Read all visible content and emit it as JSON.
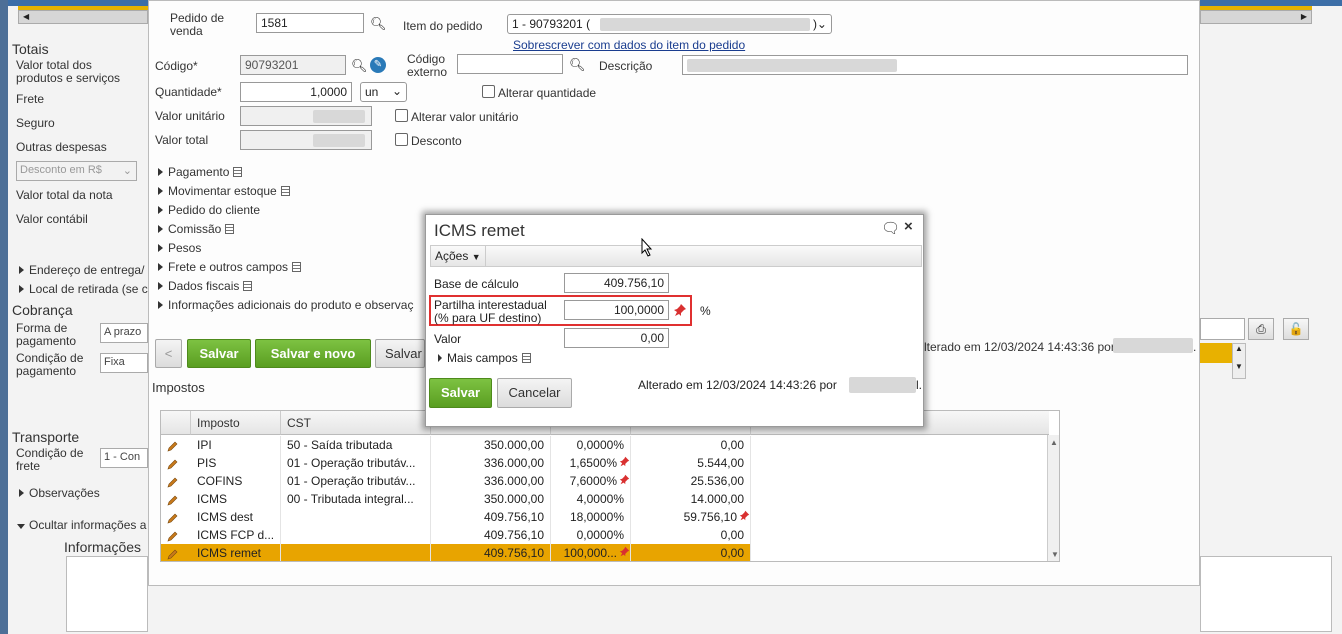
{
  "background": {
    "totais": {
      "title": "Totais",
      "items": [
        "Valor total dos produtos e serviços",
        "Frete",
        "Seguro",
        "Outras despesas"
      ],
      "desconto_select": "Desconto em R$",
      "items2": [
        "Valor total da nota",
        "Valor contábil"
      ]
    },
    "expanders": [
      "Endereço de entrega/",
      "Local de retirada (se c"
    ],
    "cobranca": {
      "title": "Cobrança",
      "forma_label": "Forma de pagamento",
      "forma_value": "A prazo",
      "condicao_label": "Condição de pagamento",
      "condicao_value": "Fixa"
    },
    "transporte": {
      "title": "Transporte",
      "condicao_frete_label": "Condição de frete",
      "condicao_frete_value": "1 - Con"
    },
    "observacoes": "Observações",
    "ocultar": "Ocultar informações a",
    "informacoes": "Informações",
    "right_altered": "lterado em 12/03/2024 14:43:36 por"
  },
  "form": {
    "pedido_venda_label": "Pedido de venda",
    "pedido_venda_value": "1581",
    "item_pedido_label": "Item do pedido",
    "item_pedido_value": "1 - 90793201 (",
    "sobrescrever_link": "Sobrescrever com dados do item do pedido",
    "codigo_label": "Código*",
    "codigo_value": "90793201",
    "codigo_externo_label": "Código externo",
    "descricao_label": "Descrição",
    "quantidade_label": "Quantidade*",
    "quantidade_value": "1,0000",
    "unidade_value": "un",
    "alterar_quantidade": "Alterar quantidade",
    "valor_unitario_label": "Valor unitário",
    "alterar_valor_unitario": "Alterar valor unitário",
    "valor_total_label": "Valor total",
    "desconto": "Desconto",
    "sections": [
      "Pagamento",
      "Movimentar estoque",
      "Pedido do cliente",
      "Comissão",
      "Pesos",
      "Frete e outros campos",
      "Dados fiscais",
      "Informações adicionais do produto e observaç"
    ],
    "prev_button": "<",
    "salvar_button": "Salvar",
    "salvar_novo_button": "Salvar e novo",
    "salvar_cut_button": "Salvar",
    "impostos_title": "Impostos"
  },
  "tax_table": {
    "headers": [
      "Imposto",
      "CST"
    ],
    "rows": [
      {
        "imposto": "IPI",
        "cst": "50 - Saída tributada",
        "base": "350.000,00",
        "aliq": "0,0000%",
        "valor": "0,00",
        "pin_aliq": false,
        "pin_valor": false
      },
      {
        "imposto": "PIS",
        "cst": "01 - Operação tributáv...",
        "base": "336.000,00",
        "aliq": "1,6500%",
        "valor": "5.544,00",
        "pin_aliq": true,
        "pin_valor": false
      },
      {
        "imposto": "COFINS",
        "cst": "01 - Operação tributáv...",
        "base": "336.000,00",
        "aliq": "7,6000%",
        "valor": "25.536,00",
        "pin_aliq": true,
        "pin_valor": false
      },
      {
        "imposto": "ICMS",
        "cst": "00 - Tributada integral...",
        "base": "350.000,00",
        "aliq": "4,0000%",
        "valor": "14.000,00",
        "pin_aliq": false,
        "pin_valor": false
      },
      {
        "imposto": "ICMS dest",
        "cst": "",
        "base": "409.756,10",
        "aliq": "18,0000%",
        "valor": "59.756,10",
        "pin_aliq": false,
        "pin_valor": true
      },
      {
        "imposto": "ICMS FCP d...",
        "cst": "",
        "base": "409.756,10",
        "aliq": "0,0000%",
        "valor": "0,00",
        "pin_aliq": false,
        "pin_valor": false
      },
      {
        "imposto": "ICMS remet",
        "cst": "",
        "base": "409.756,10",
        "aliq": "100,000...",
        "valor": "0,00",
        "pin_aliq": true,
        "pin_valor": false
      }
    ]
  },
  "dialog": {
    "title": "ICMS remet",
    "acoes": "Ações",
    "base_label": "Base de cálculo",
    "base_value": "409.756,10",
    "partilha_label_1": "Partilha interestadual",
    "partilha_label_2": "(% para UF destino)",
    "partilha_value": "100,0000",
    "percent": "%",
    "valor_label": "Valor",
    "valor_value": "0,00",
    "mais_campos": "Mais campos",
    "salvar": "Salvar",
    "cancelar": "Cancelar",
    "altered": "Alterado em 12/03/2024 14:43:26 por",
    "altered_suffix": "l."
  },
  "colors": {
    "accent_green": "#6aaf2f",
    "selected_row": "#e8a400",
    "highlight_red": "#e03030",
    "link_blue": "#1a3d8f"
  }
}
